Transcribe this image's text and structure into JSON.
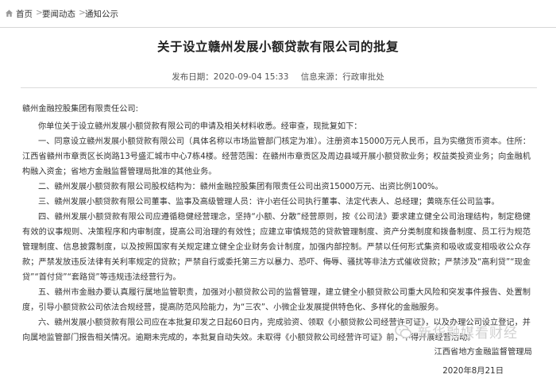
{
  "breadcrumb": {
    "home": "首页",
    "section": "要闻动态",
    "current": "通知公示"
  },
  "document": {
    "title": "关于设立赣州发展小额贷款有限公司的批复",
    "publish_date": "发布日期：2020-09-04 15:33",
    "source": "信息来源：行政审批处",
    "salutation": "赣州金融控股集团有限责任公司:",
    "paragraphs": [
      "你单位关于设立赣州发展小额贷款有限公司的申请及相关材料收悉。经审查，现批复如下：",
      "一、同意设立赣州发展小额贷款有限公司（具体名称以市场监管部门核定为准）。注册资本15000万元人民币，且为实缴货币资本。住所：江西省赣州市章贡区长岗路13号盛汇城市中心7栋4楼。经营范围：在赣州市章贡区及周边县域开展小额贷款业务；权益类投资业务；向金融机构融入资金；省地方金融监督管理局批准的其他业务。",
      "二、赣州发展小额贷款有限公司股权结构为：赣州金融控股集团有限责任公司出资15000万元、出资比例100%。",
      "三、赣州发展小额贷款有限公司董事、监事及高级管理人员：许小岩任公司执行董事、法定代表人、总经理；黄晓东任公司监事。",
      "四、赣州发展小额贷款有限公司应遵循稳健经营理念，坚持“小额、分散”经营原则，按《公司法》要求建立健全公司治理结构，制定稳健有效的议事规则、决策程序和内审制度，提高公司治理的有效性；应建立审慎规范的贷款管理制度、资产分类制度和拨备制度、员工行为规范管理制度、信息披露制度，以及按照国家有关规定建立健全企业财务会计制度，加强内部控制。严禁以任何形式集资和吸收或变相吸收公众存款；严禁发放违反法律有关利率规定的贷款；严禁自行或委托第三方以暴力、恐吓、侮辱、骚扰等非法方式催收贷款；严禁涉及“高利贷”“现金贷”“首付贷”“套路贷”等违规违法经营行为。",
      "五、赣州市金融办要认真履行属地监管职责，加强对小额贷款公司的监督管理，建立健全小额贷款公司重大风险和突发事件报告、处置制度，引导小额贷款公司依法合规经营，提高防范风险能力，为“三农”、小微企业发展提供特色化、多样化的金融服务。",
      "六、赣州发展小额贷款有限公司应在本批复印发之日起60日内，完成验资、领取《小额贷款公司经营许可证》，以及办理公司设立登记，并向属地监管部门报告相关情况。逾期未完成的，本批复自动失效。未取得《小额贷款公司经营许可证》前，不得开展经营活动。"
    ],
    "signature_org": "江西省地方金融监督管理局",
    "signature_date": "2020年8月21日"
  },
  "watermark": {
    "text": "新华融媒看财经",
    "icon": "wechat-icon"
  }
}
